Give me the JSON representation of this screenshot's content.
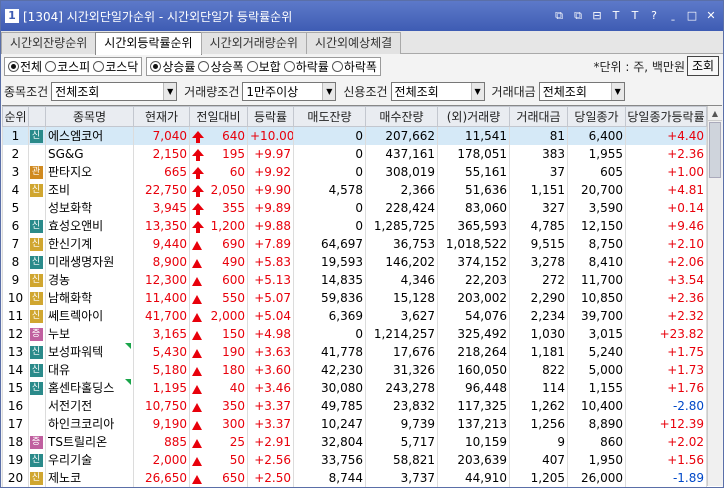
{
  "title": {
    "num": "1",
    "text": "[1304] 시간외단일가순위 - 시간외단일가 등락률순위"
  },
  "tb_icons": [
    "⧉",
    "⧉",
    "⊟",
    "T",
    "T",
    "?",
    "ˍ",
    "□",
    "✕"
  ],
  "tabs": [
    "시간외잔량순위",
    "시간외등락률순위",
    "시간외거래량순위",
    "시간외예상체결"
  ],
  "active_tab": 1,
  "market": {
    "options": [
      "전체",
      "코스피",
      "코스닥"
    ],
    "selected": 0
  },
  "sort": {
    "options": [
      "상승률",
      "상승폭",
      "보합",
      "하락률",
      "하락폭"
    ],
    "selected": 0
  },
  "unit_text": "*단위 : 주, 백만원",
  "search_label": "조회",
  "filters": [
    {
      "label": "종목조건",
      "value": "전체조회"
    },
    {
      "label": "거래량조건",
      "value": "1만주이상"
    },
    {
      "label": "신용조건",
      "value": "전체조회"
    },
    {
      "label": "거래대금",
      "value": "전체조회"
    }
  ],
  "columns": [
    "순위",
    "",
    "종목명",
    "현재가",
    "전일대비",
    "등락률",
    "매도잔량",
    "매수잔량",
    "(외)거래량",
    "거래대금",
    "당일종가",
    "당일종가등락률"
  ],
  "rows": [
    {
      "rank": "1",
      "badge": "신",
      "bt": "sin",
      "name": "에스엠코어",
      "price": "7,040",
      "arrow": "big",
      "diff": "640",
      "rate": "+10.00",
      "sell": "0",
      "buy": "207,662",
      "vol": "11,541",
      "amt": "81",
      "close": "6,400",
      "crate": "+4.40",
      "cc": "red",
      "mark": false
    },
    {
      "rank": "2",
      "badge": "",
      "bt": "",
      "name": "SG&G",
      "price": "2,150",
      "arrow": "big",
      "diff": "195",
      "rate": "+9.97",
      "sell": "0",
      "buy": "437,161",
      "vol": "178,051",
      "amt": "383",
      "close": "1,955",
      "crate": "+2.36",
      "cc": "red",
      "mark": false
    },
    {
      "rank": "3",
      "badge": "관",
      "bt": "pan",
      "name": "판타지오",
      "price": "665",
      "arrow": "big",
      "diff": "60",
      "rate": "+9.92",
      "sell": "0",
      "buy": "308,019",
      "vol": "55,161",
      "amt": "37",
      "close": "605",
      "crate": "+1.00",
      "cc": "red",
      "mark": false
    },
    {
      "rank": "4",
      "badge": "신",
      "bt": "sin2",
      "name": "조비",
      "price": "22,750",
      "arrow": "big",
      "diff": "2,050",
      "rate": "+9.90",
      "sell": "4,578",
      "buy": "2,366",
      "vol": "51,636",
      "amt": "1,151",
      "close": "20,700",
      "crate": "+4.81",
      "cc": "red",
      "mark": false
    },
    {
      "rank": "5",
      "badge": "",
      "bt": "",
      "name": "성보화학",
      "price": "3,945",
      "arrow": "big",
      "diff": "355",
      "rate": "+9.89",
      "sell": "0",
      "buy": "228,424",
      "vol": "83,060",
      "amt": "327",
      "close": "3,590",
      "crate": "+0.14",
      "cc": "red",
      "mark": false
    },
    {
      "rank": "6",
      "badge": "신",
      "bt": "sin",
      "name": "효성오앤비",
      "price": "13,350",
      "arrow": "big",
      "diff": "1,200",
      "rate": "+9.88",
      "sell": "0",
      "buy": "1,285,725",
      "vol": "365,593",
      "amt": "4,785",
      "close": "12,150",
      "crate": "+9.46",
      "cc": "red",
      "mark": false
    },
    {
      "rank": "7",
      "badge": "신",
      "bt": "sin2",
      "name": "한신기계",
      "price": "9,440",
      "arrow": "tri",
      "diff": "690",
      "rate": "+7.89",
      "sell": "64,697",
      "buy": "36,753",
      "vol": "1,018,522",
      "amt": "9,515",
      "close": "8,750",
      "crate": "+2.10",
      "cc": "red",
      "mark": false
    },
    {
      "rank": "8",
      "badge": "신",
      "bt": "sin",
      "name": "미래생명자원",
      "price": "8,900",
      "arrow": "tri",
      "diff": "490",
      "rate": "+5.83",
      "sell": "19,593",
      "buy": "146,202",
      "vol": "374,152",
      "amt": "3,278",
      "close": "8,410",
      "crate": "+2.06",
      "cc": "red",
      "mark": false
    },
    {
      "rank": "9",
      "badge": "신",
      "bt": "sin2",
      "name": "경농",
      "price": "12,300",
      "arrow": "tri",
      "diff": "600",
      "rate": "+5.13",
      "sell": "14,835",
      "buy": "4,346",
      "vol": "22,203",
      "amt": "272",
      "close": "11,700",
      "crate": "+3.54",
      "cc": "red",
      "mark": false
    },
    {
      "rank": "10",
      "badge": "신",
      "bt": "sin2",
      "name": "남해화학",
      "price": "11,400",
      "arrow": "tri",
      "diff": "550",
      "rate": "+5.07",
      "sell": "59,836",
      "buy": "15,128",
      "vol": "203,002",
      "amt": "2,290",
      "close": "10,850",
      "crate": "+2.36",
      "cc": "red",
      "mark": false
    },
    {
      "rank": "11",
      "badge": "신",
      "bt": "sin2",
      "name": "쎄트렉아이",
      "price": "41,700",
      "arrow": "tri",
      "diff": "2,000",
      "rate": "+5.04",
      "sell": "6,369",
      "buy": "3,627",
      "vol": "54,076",
      "amt": "2,234",
      "close": "39,700",
      "crate": "+2.32",
      "cc": "red",
      "mark": false
    },
    {
      "rank": "12",
      "badge": "증",
      "bt": "jeung",
      "name": "누보",
      "price": "3,165",
      "arrow": "tri",
      "diff": "150",
      "rate": "+4.98",
      "sell": "0",
      "buy": "1,214,257",
      "vol": "325,492",
      "amt": "1,030",
      "close": "3,015",
      "crate": "+23.82",
      "cc": "red",
      "mark": false
    },
    {
      "rank": "13",
      "badge": "신",
      "bt": "sin",
      "name": "보성파워텍",
      "price": "5,430",
      "arrow": "tri",
      "diff": "190",
      "rate": "+3.63",
      "sell": "41,778",
      "buy": "17,676",
      "vol": "218,264",
      "amt": "1,181",
      "close": "5,240",
      "crate": "+1.75",
      "cc": "red",
      "mark": true
    },
    {
      "rank": "14",
      "badge": "신",
      "bt": "sin",
      "name": "대유",
      "price": "5,180",
      "arrow": "tri",
      "diff": "180",
      "rate": "+3.60",
      "sell": "42,230",
      "buy": "31,326",
      "vol": "160,050",
      "amt": "822",
      "close": "5,000",
      "crate": "+1.73",
      "cc": "red",
      "mark": false
    },
    {
      "rank": "15",
      "badge": "신",
      "bt": "sin",
      "name": "홈센타홀딩스",
      "price": "1,195",
      "arrow": "tri",
      "diff": "40",
      "rate": "+3.46",
      "sell": "30,080",
      "buy": "243,278",
      "vol": "96,448",
      "amt": "114",
      "close": "1,155",
      "crate": "+1.76",
      "cc": "red",
      "mark": true
    },
    {
      "rank": "16",
      "badge": "",
      "bt": "",
      "name": "서전기전",
      "price": "10,750",
      "arrow": "tri",
      "diff": "350",
      "rate": "+3.37",
      "sell": "49,785",
      "buy": "23,832",
      "vol": "117,325",
      "amt": "1,262",
      "close": "10,400",
      "crate": "-2.80",
      "cc": "blue",
      "mark": false
    },
    {
      "rank": "17",
      "badge": "",
      "bt": "",
      "name": "하인크코리아",
      "price": "9,190",
      "arrow": "tri",
      "diff": "300",
      "rate": "+3.37",
      "sell": "10,247",
      "buy": "9,739",
      "vol": "137,213",
      "amt": "1,256",
      "close": "8,890",
      "crate": "+12.39",
      "cc": "red",
      "mark": false
    },
    {
      "rank": "18",
      "badge": "증",
      "bt": "jeung",
      "name": "TS트릴리온",
      "price": "885",
      "arrow": "tri",
      "diff": "25",
      "rate": "+2.91",
      "sell": "32,804",
      "buy": "5,717",
      "vol": "10,159",
      "amt": "9",
      "close": "860",
      "crate": "+2.02",
      "cc": "red",
      "mark": false
    },
    {
      "rank": "19",
      "badge": "신",
      "bt": "sin",
      "name": "우리기술",
      "price": "2,000",
      "arrow": "tri",
      "diff": "50",
      "rate": "+2.56",
      "sell": "33,756",
      "buy": "58,821",
      "vol": "203,639",
      "amt": "407",
      "close": "1,950",
      "crate": "+1.56",
      "cc": "red",
      "mark": false
    },
    {
      "rank": "20",
      "badge": "신",
      "bt": "sin2",
      "name": "제노코",
      "price": "26,650",
      "arrow": "tri",
      "diff": "650",
      "rate": "+2.50",
      "sell": "8,744",
      "buy": "3,737",
      "vol": "44,910",
      "amt": "1,205",
      "close": "26,000",
      "crate": "-1.89",
      "cc": "blue",
      "mark": false
    }
  ]
}
